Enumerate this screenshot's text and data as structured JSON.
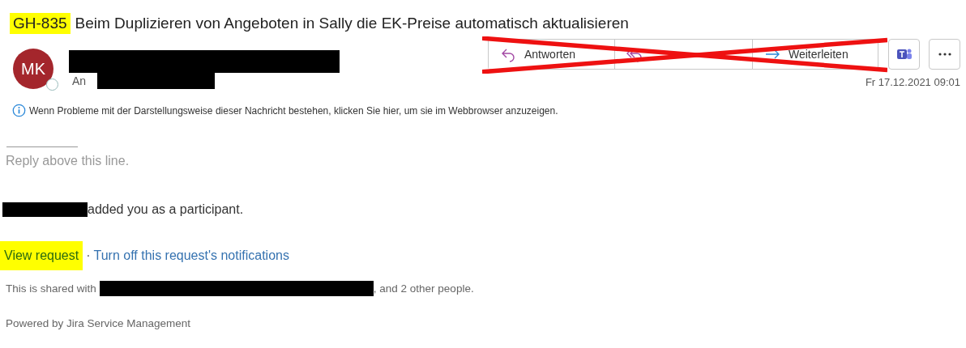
{
  "subject": {
    "key": "GH-835",
    "key_highlighted": true,
    "title": "Beim Duplizieren von Angeboten in Sally die EK-Preise automatisch aktualisieren"
  },
  "sender": {
    "initials": "MK",
    "to_label": "An"
  },
  "actions": [
    {
      "kind": "reply",
      "label": "Antworten"
    },
    {
      "kind": "reply-all"
    },
    {
      "kind": "forward",
      "label": "Weiterleiten"
    }
  ],
  "actions_crossed_out": true,
  "date": "Fr 17.12.2021 09:01",
  "info_bar": "Wenn Probleme mit der Darstellungsweise dieser Nachricht bestehen, klicken Sie hier, um sie im Webbrowser anzuzeigen.",
  "body": {
    "reply_marker": "Reply above this line.",
    "participant_text": "added you as a participant.",
    "links": [
      {
        "label": "View request",
        "highlighted": true
      },
      {
        "label": "Turn off this request's notifications",
        "highlighted": false
      }
    ],
    "separator": "·",
    "shared_prefix": "This is shared with",
    "shared_suffix": ", and 2 other people.",
    "footer": "Powered by Jira Service Management"
  }
}
